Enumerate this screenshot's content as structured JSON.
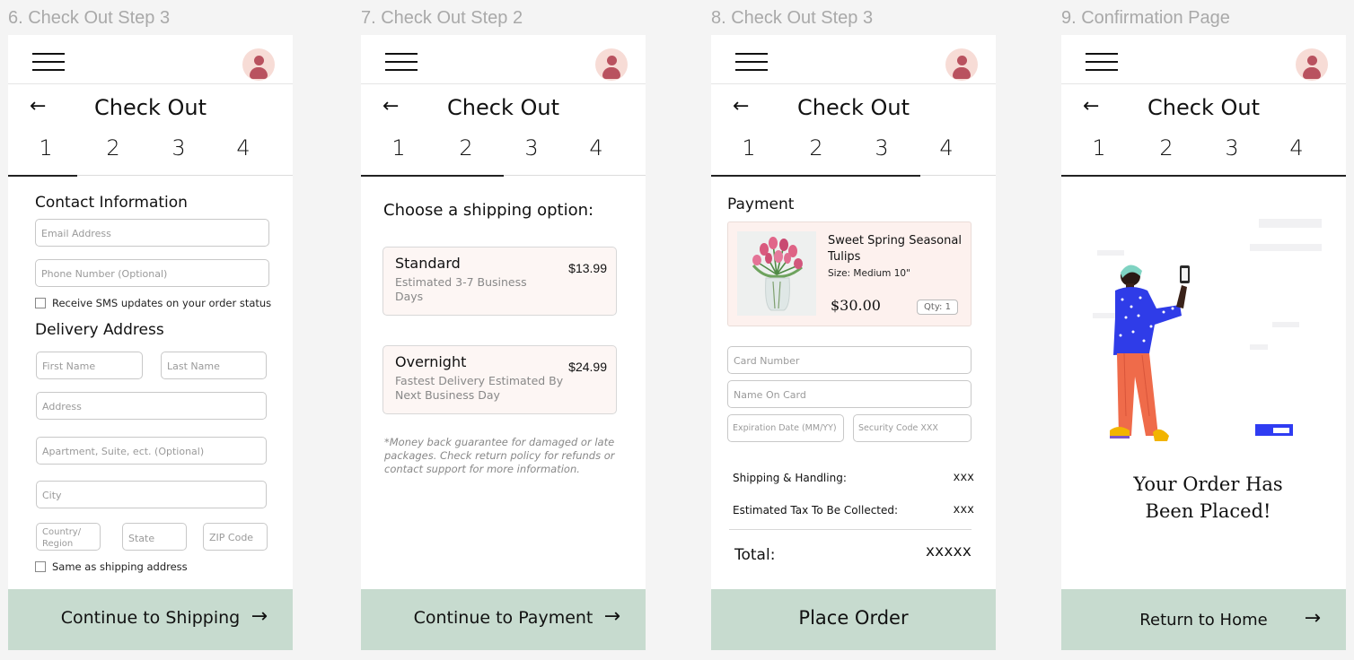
{
  "frames": [
    {
      "title": "6. Check Out Step 3",
      "active_step": 1,
      "cta_label": "Continue to Shipping"
    },
    {
      "title": "7. Check Out Step 2",
      "active_step": 2,
      "cta_label": "Continue to Payment"
    },
    {
      "title": "8. Check Out Step 3",
      "active_step": 3,
      "cta_label": "Place Order"
    },
    {
      "title": "9. Confirmation Page",
      "active_step": 4,
      "cta_label": "Return to Home"
    }
  ],
  "common": {
    "page_title": "Check Out",
    "steps": [
      "1",
      "2",
      "3",
      "4"
    ],
    "back_icon": "←",
    "arrow_icon": "→"
  },
  "contact": {
    "section_title": "Contact Information",
    "email_placeholder": "Email Address",
    "phone_placeholder": "Phone Number (Optional)",
    "sms_label": "Receive SMS updates on your order status"
  },
  "delivery": {
    "section_title": "Delivery Address",
    "first_name": "First Name",
    "last_name": "Last Name",
    "address": "Address",
    "apartment": "Apartment, Suite, ect. (Optional)",
    "city": "City",
    "country": "Country/ Region",
    "state": "State",
    "zip": "ZIP Code",
    "same_as_shipping": "Same as shipping address"
  },
  "shipping": {
    "heading": "Choose a shipping option:",
    "options": [
      {
        "name": "Standard",
        "description": "Estimated 3-7 Business Days",
        "price": "$13.99"
      },
      {
        "name": "Overnight",
        "description": "Fastest Delivery Estimated By Next Business Day",
        "price": "$24.99"
      }
    ],
    "disclaimer": "*Money back guarantee for damaged or late packages. Check return policy for refunds or contact support for more information."
  },
  "payment": {
    "section_title": "Payment",
    "product": {
      "name": "Sweet Spring Seasonal Tulips",
      "size": "Size: Medium 10\"",
      "price": "$30.00",
      "qty": "Qty: 1"
    },
    "card_number": "Card Number",
    "name_on_card": "Name On Card",
    "expiration": "Expiration Date (MM/YY)",
    "security_code": "Security Code XXX",
    "shipping_label": "Shipping & Handling:",
    "shipping_value": "xxx",
    "tax_label": "Estimated Tax To Be Collected:",
    "tax_value": "xxx",
    "total_label": "Total:",
    "total_value": "xxxxx"
  },
  "confirmation": {
    "message": "Your Order Has Been Placed!"
  },
  "colors": {
    "cta_bg": "#c7dbcf",
    "card_bg": "#fdf6f4",
    "avatar_bg": "#f7dcd6",
    "avatar_fg": "#b9525f"
  }
}
